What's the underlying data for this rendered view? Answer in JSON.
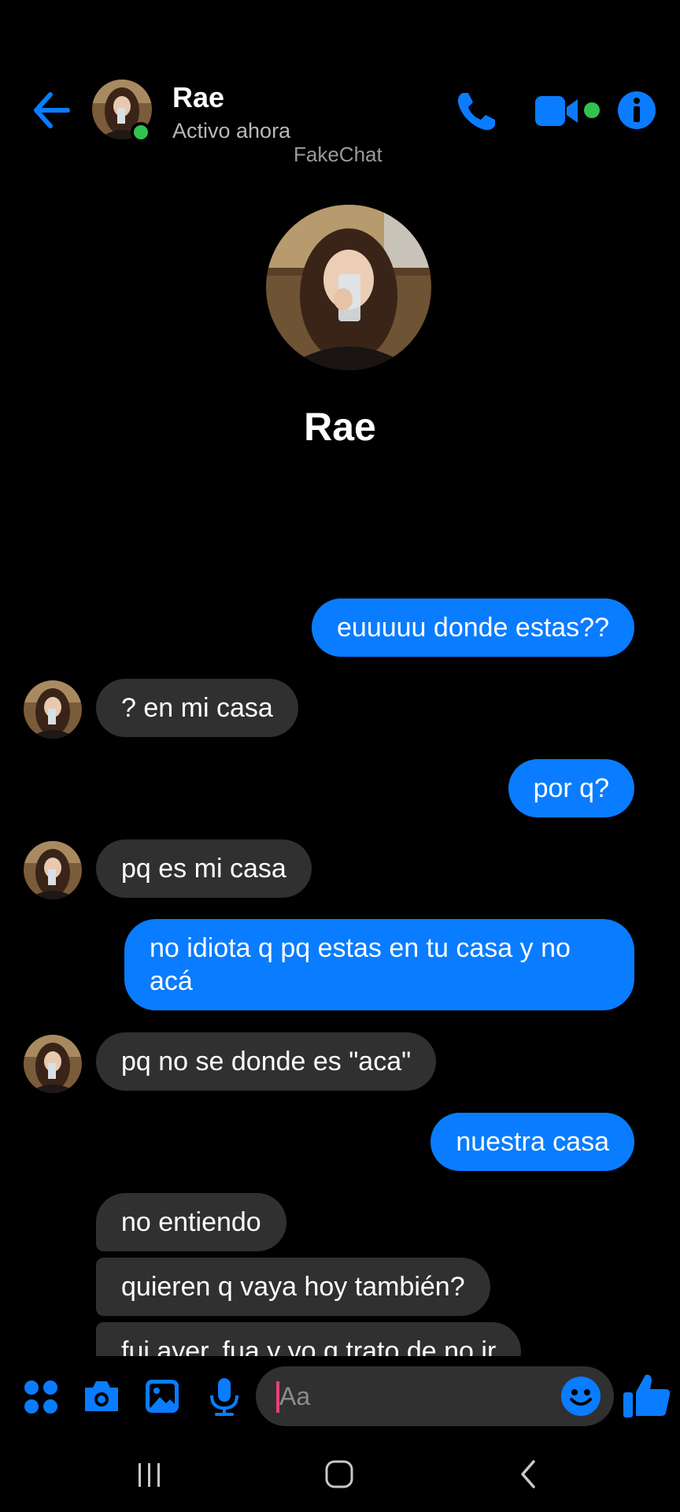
{
  "header": {
    "contact_name": "Rae",
    "status": "Activo ahora",
    "watermark": "FakeChat",
    "icons": [
      "back-arrow-icon",
      "phone-icon",
      "video-camera-icon",
      "info-icon"
    ],
    "accent_color": "#0a7cff",
    "online_color": "#31c24f"
  },
  "profile": {
    "name": "Rae"
  },
  "messages": [
    {
      "from": "me",
      "text": "euuuuu donde estas??"
    },
    {
      "from": "them",
      "text": "? en mi casa"
    },
    {
      "from": "me",
      "text": "por q?"
    },
    {
      "from": "them",
      "text": "pq es mi casa"
    },
    {
      "from": "me",
      "text": "no idiota q pq estas en tu casa y no acá"
    },
    {
      "from": "them",
      "text": "pq no se donde es \"aca\""
    },
    {
      "from": "me",
      "text": "nuestra casa"
    },
    {
      "from": "them",
      "text": "no entiendo"
    },
    {
      "from": "them",
      "text": "quieren q vaya hoy también?"
    },
    {
      "from": "them",
      "text": "fui ayer, fua y yo q trato de no ir"
    }
  ],
  "composer": {
    "placeholder": "Aa",
    "icons": [
      "apps-grid-icon",
      "camera-icon",
      "gallery-icon",
      "microphone-icon",
      "emoji-icon",
      "thumbs-up-icon"
    ]
  },
  "navbar": {
    "icons": [
      "recent-apps-icon",
      "home-icon",
      "back-icon"
    ]
  }
}
